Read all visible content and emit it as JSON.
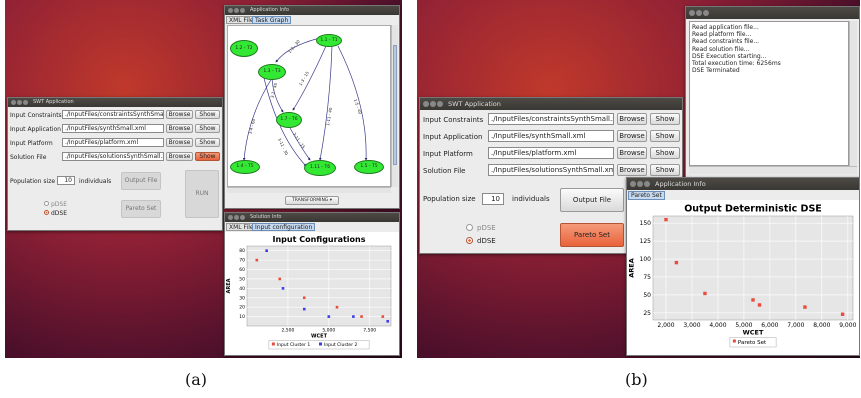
{
  "captions": {
    "a": "(a)",
    "b": "(b)"
  },
  "swt": {
    "title": "SWT Application",
    "rows": [
      {
        "label": "Input Constraints",
        "a_value": "./InputFiles/constraintsSynthSmall.xm",
        "b_value": "./InputFiles/constraintsSynthSmall.xml"
      },
      {
        "label": "Input Application",
        "a_value": "./InputFiles/synthSmall.xml",
        "b_value": "./InputFiles/synthSmall.xml"
      },
      {
        "label": "Input Platform",
        "a_value": "./InputFiles/platform.xml",
        "b_value": "./InputFiles/platform.xml"
      },
      {
        "label": "Solution File",
        "a_value": "./InputFiles/solutionsSynthSmall.xml",
        "b_value": "./InputFiles/solutionsSynthSmall.xml"
      }
    ],
    "browse_label": "Browse",
    "show_label": "Show",
    "population_label": "Population size",
    "population_value": "10",
    "individuals_label": "individuals",
    "output_file_label": "Output File",
    "pareto_set_label": "Pareto Set",
    "run_label": "RUN",
    "pdse_label": "pDSE",
    "ddse_label": "dDSE"
  },
  "app_info_a": {
    "title": "Application Info",
    "tabs": [
      "XML File",
      "Task Graph"
    ],
    "nodes": [
      "1.1 - T1",
      "1.2 - T2",
      "1.3 - T3",
      "1.7 - T6",
      "1.4 - T5",
      "1.11 - T6",
      "1.5 - T5"
    ],
    "edge_labels": [
      "1-3 - 30",
      "1-3 - 15",
      "3-7 - 45",
      "1-4 - 60",
      "7-11 - 15",
      "1-11 - 40",
      "3-11 - 30",
      "1-5 - 40"
    ],
    "layout_select": "TRANSFORMING"
  },
  "solution_info": {
    "title": "Solution Info",
    "tabs": [
      "XML File",
      "Input configuration"
    ],
    "chart_title": "Input Configurations",
    "ylabel": "AREA",
    "xlabel": "WCET",
    "legend": [
      "Input Cluster 1",
      "Input Cluster 2"
    ]
  },
  "log_b": {
    "lines": [
      "Read application file...",
      "Read platform file...",
      "Read constraints file...",
      "Read solution file...",
      "DSE Execution starting...",
      "Total execution time: 6256ms",
      "DSE Terminated"
    ]
  },
  "app_info_b": {
    "title": "Application Info",
    "tab": "Pareto Set",
    "chart_title": "Output Deterministic DSE",
    "ylabel": "AREA",
    "xlabel": "WCET",
    "legend": [
      "Pareto Set"
    ]
  },
  "colors": {
    "cluster1": "#e74c3c",
    "cluster2": "#3b3bf0",
    "pareto": "#e74c3c",
    "node": "#33e833",
    "accent": "#e9623a"
  },
  "chart_data": [
    {
      "type": "scatter",
      "title": "Input Configurations",
      "xlabel": "WCET",
      "ylabel": "AREA",
      "xlim": [
        0,
        8800
      ],
      "ylim": [
        0,
        85
      ],
      "xticks": [
        "2,500",
        "5,000",
        "7,500"
      ],
      "yticks": [
        "10",
        "20",
        "30",
        "40",
        "50",
        "60",
        "70",
        "80"
      ],
      "legend_position": "bottom",
      "series": [
        {
          "name": "Input Cluster 1",
          "color": "#e74c3c",
          "points": [
            [
              600,
              70
            ],
            [
              2000,
              50
            ],
            [
              3500,
              30
            ],
            [
              5500,
              20
            ],
            [
              7000,
              10
            ],
            [
              8300,
              10
            ]
          ]
        },
        {
          "name": "Input Cluster 2",
          "color": "#3b3bf0",
          "points": [
            [
              1200,
              80
            ],
            [
              2200,
              40
            ],
            [
              3500,
              18
            ],
            [
              5000,
              10
            ],
            [
              6500,
              10
            ],
            [
              8600,
              5
            ]
          ]
        }
      ]
    },
    {
      "type": "scatter",
      "title": "Output Deterministic DSE",
      "xlabel": "WCET",
      "ylabel": "AREA",
      "xlim": [
        1500,
        9200
      ],
      "ylim": [
        15,
        160
      ],
      "xticks": [
        "2,000",
        "3,000",
        "4,000",
        "5,000",
        "6,000",
        "7,000",
        "8,000",
        "9,000"
      ],
      "yticks": [
        "25",
        "50",
        "75",
        "100",
        "125",
        "150"
      ],
      "legend_position": "bottom",
      "series": [
        {
          "name": "Pareto Set",
          "color": "#e74c3c",
          "points": [
            [
              2000,
              155
            ],
            [
              2400,
              95
            ],
            [
              3500,
              52
            ],
            [
              5350,
              43
            ],
            [
              5600,
              36
            ],
            [
              7350,
              33
            ],
            [
              8800,
              23
            ]
          ]
        }
      ]
    }
  ]
}
